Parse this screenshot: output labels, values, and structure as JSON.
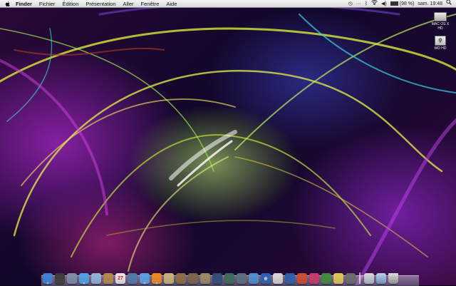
{
  "menubar": {
    "apple_icon": "apple-logo-icon",
    "items": [
      "Finder",
      "Fichier",
      "Édition",
      "Présentation",
      "Aller",
      "Fenêtre",
      "Aide"
    ],
    "status": {
      "timemachine_icon": "time-machine-icon",
      "extra_icon": "menu-extra-dots-icon",
      "bluetooth_icon": "bluetooth-icon",
      "wifi_icon": "wifi-icon",
      "volume_icon": "volume-icon",
      "battery_icon": "battery-icon",
      "battery_text": "(98 %)",
      "battery_level": 0.98,
      "clock": "sam. 19:48",
      "spotlight_icon": "spotlight-search-icon"
    }
  },
  "desktop": {
    "icons": [
      {
        "label": "MAC OS X HD",
        "icon": "internal-drive-icon"
      },
      {
        "label": "WD HD",
        "icon": "usb-drive-icon"
      }
    ]
  },
  "dock": {
    "items": [
      {
        "name": "finder",
        "color": "#3d7fd6"
      },
      {
        "name": "dashboard",
        "color": "#3b3b3b"
      },
      {
        "name": "system-preferences",
        "color": "#7d8ea8"
      },
      {
        "name": "safari",
        "color": "#4aa3e6"
      },
      {
        "name": "mail",
        "color": "#8fb4d9"
      },
      {
        "name": "address-book",
        "color": "#b58a4c"
      },
      {
        "name": "ical",
        "color": "#e9e9e9",
        "glyph": "27"
      },
      {
        "name": "iphoto",
        "color": "#4d7aa8"
      },
      {
        "name": "itunes",
        "color": "#5aa0e0"
      },
      {
        "name": "vlc",
        "color": "#f08a1c"
      },
      {
        "name": "garageband",
        "color": "#c9b57a"
      },
      {
        "name": "image-capture",
        "color": "#8c6d3f"
      },
      {
        "name": "preview",
        "color": "#7a6448"
      },
      {
        "name": "toolbox-app",
        "color": "#9a8a66"
      },
      {
        "name": "spaces",
        "color": "#2f4d77"
      },
      {
        "name": "time-machine",
        "color": "#3c6b5a"
      },
      {
        "name": "activity-monitor",
        "color": "#5b6e7f"
      },
      {
        "name": "messenger",
        "color": "#4f8fd0"
      },
      {
        "name": "omni-app",
        "color": "#2c5fb6",
        "glyph": "e"
      },
      {
        "name": "acrobat",
        "color": "#d8d8d8"
      },
      {
        "name": "word-app",
        "color": "#2d5ea8"
      },
      {
        "name": "office-app-1",
        "color": "#d14a2f"
      },
      {
        "name": "office-app-2",
        "color": "#c83a6a"
      },
      {
        "name": "excel-app",
        "color": "#3e8c3a"
      },
      {
        "name": "notes-app",
        "color": "#e0c85a"
      },
      {
        "name": "calculator",
        "color": "#6b6b6b"
      }
    ],
    "stack_icon": "downloads-stack-icon",
    "applications_icon": "applications-folder-icon",
    "trash_icon": "trash-icon"
  }
}
